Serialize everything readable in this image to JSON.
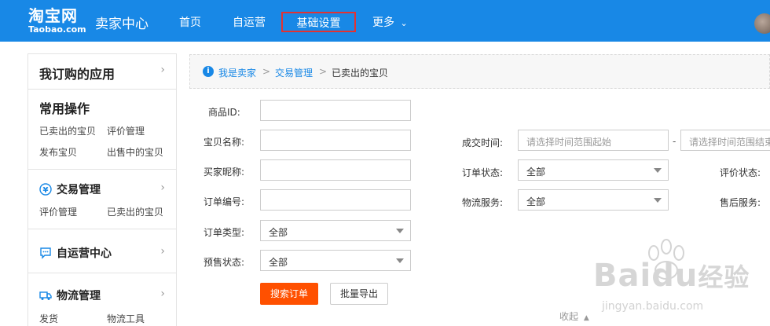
{
  "header": {
    "logo_cn": "淘宝网",
    "logo_en": "Taobao.com",
    "brand": "卖家中心",
    "nav": [
      "首页",
      "自运营",
      "基础设置",
      "更多"
    ]
  },
  "sidebar": {
    "apps_title": "我订购的应用",
    "common_title": "常用操作",
    "common_links": [
      "已卖出的宝贝",
      "评价管理",
      "发布宝贝",
      "出售中的宝贝"
    ],
    "trade_title": "交易管理",
    "trade_links": [
      "评价管理",
      "已卖出的宝贝"
    ],
    "self_title": "自运营中心",
    "logistics_title": "物流管理",
    "logistics_links": [
      "发货",
      "物流工具"
    ]
  },
  "breadcrumb": [
    "我是卖家",
    "交易管理",
    "已卖出的宝贝"
  ],
  "form": {
    "product_id": "商品ID:",
    "item_name": "宝贝名称:",
    "buyer_nick": "买家昵称:",
    "order_no": "订单编号:",
    "order_type": "订单类型:",
    "order_type_value": "全部",
    "presale": "预售状态:",
    "presale_value": "全部",
    "deal_time": "成交时间:",
    "time_start_placeholder": "请选择时间范围起始",
    "time_dash": "-",
    "time_end_placeholder": "请选择时间范围结束",
    "order_status": "订单状态:",
    "order_status_value": "全部",
    "logistics": "物流服务:",
    "logistics_value": "全部",
    "review_status": "评价状态:",
    "aftersale": "售后服务:"
  },
  "buttons": {
    "search": "搜索订单",
    "export": "批量导出",
    "collapse": "收起"
  },
  "watermark": {
    "brand": "Baidu",
    "cn": "经验",
    "url": "jingyan.baidu.com"
  },
  "colors": {
    "topbar": "#1888e6",
    "primary_button": "#ff5000",
    "highlight_border": "#e23232"
  }
}
